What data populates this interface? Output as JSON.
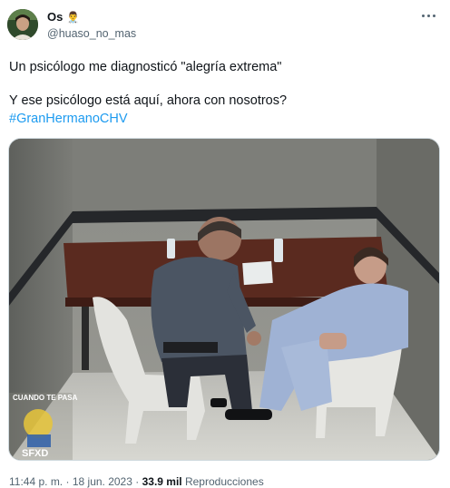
{
  "author": {
    "name": "Os",
    "badge_emoji": "👨‍⚕️",
    "handle": "@huaso_no_mas",
    "avatar_icon": "profile-avatar"
  },
  "tweet": {
    "line1": "Un psicólogo me diagnosticó \"alegría extrema\"",
    "line2": "Y ese psicólogo está aquí, ahora con nosotros?",
    "hashtag": "#GranHermanoCHV"
  },
  "media": {
    "alt_icon": "interrogation-room-photo",
    "watermark_top": "CUANDO TE PASA",
    "watermark_bottom": "SFXD"
  },
  "meta": {
    "time": "11:44 p. m.",
    "separator": "·",
    "date": "18 jun. 2023",
    "views_count": "33.9 mil",
    "views_label": "Reproducciones"
  },
  "colors": {
    "link": "#1d9bf0",
    "secondary_text": "#536471",
    "primary_text": "#0f1419"
  }
}
